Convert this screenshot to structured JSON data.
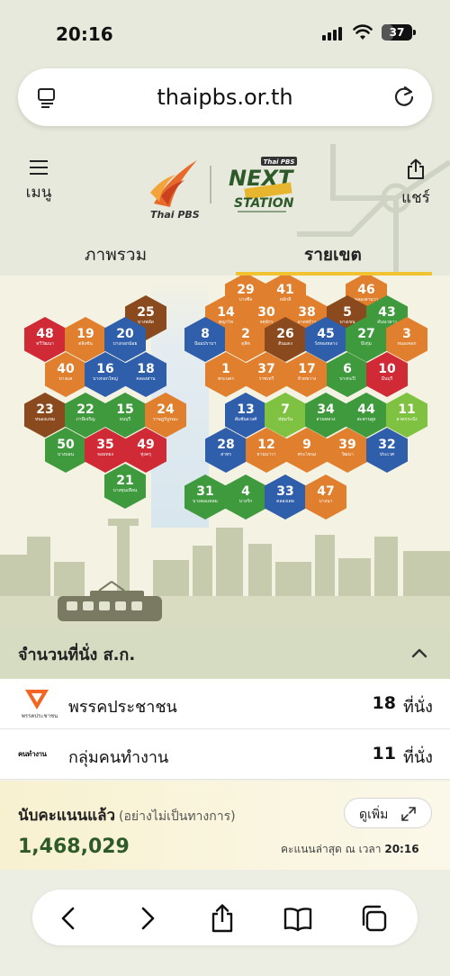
{
  "status_bar": {
    "time": "20:16",
    "battery": "37",
    "battery_level": 0.37
  },
  "browser": {
    "domain": "thaipbs.or.th"
  },
  "header": {
    "menu_label": "เมนู",
    "share_label": "แชร์",
    "logo_text": "Thai PBS",
    "event_logo_text": "Thai PBS NEXT STATION"
  },
  "tabs": [
    {
      "label": "ภาพรวม",
      "active": false
    },
    {
      "label": "รายเขต",
      "active": true
    }
  ],
  "map": {
    "colors": {
      "orange": "#e07f2e",
      "brown": "#8a4a1e",
      "blue": "#2f5fab",
      "green": "#3e9a3c",
      "lightgreen": "#7fc241",
      "red": "#cf2a36"
    },
    "districts": [
      {
        "n": "29",
        "name": "บางซื่อ",
        "c": "orange"
      },
      {
        "n": "41",
        "name": "หลักสี่",
        "c": "orange"
      },
      {
        "n": "46",
        "name": "คลองสามวา",
        "c": "orange"
      },
      {
        "n": "25",
        "name": "บางพลัด",
        "c": "brown"
      },
      {
        "n": "14",
        "name": "พญาไท",
        "c": "orange"
      },
      {
        "n": "30",
        "name": "จตุจักร",
        "c": "orange"
      },
      {
        "n": "38",
        "name": "ลาดพร้าว",
        "c": "orange"
      },
      {
        "n": "5",
        "name": "บางเขน",
        "c": "brown"
      },
      {
        "n": "43",
        "name": "คันนายาว",
        "c": "green"
      },
      {
        "n": "48",
        "name": "ทวีวัฒนา",
        "c": "red"
      },
      {
        "n": "19",
        "name": "ตลิ่งชัน",
        "c": "orange"
      },
      {
        "n": "20",
        "name": "บางกอกน้อย",
        "c": "blue"
      },
      {
        "n": "8",
        "name": "ป้อมปราบฯ",
        "c": "blue"
      },
      {
        "n": "2",
        "name": "ดุสิต",
        "c": "orange"
      },
      {
        "n": "26",
        "name": "ดินแดง",
        "c": "brown"
      },
      {
        "n": "45",
        "name": "วังทองหลาง",
        "c": "blue"
      },
      {
        "n": "27",
        "name": "บึงกุ่ม",
        "c": "green"
      },
      {
        "n": "3",
        "name": "หนองจอก",
        "c": "orange"
      },
      {
        "n": "40",
        "name": "บางแค",
        "c": "orange"
      },
      {
        "n": "16",
        "name": "บางกอกใหญ่",
        "c": "blue"
      },
      {
        "n": "18",
        "name": "คลองสาน",
        "c": "blue"
      },
      {
        "n": "1",
        "name": "พระนคร",
        "c": "orange"
      },
      {
        "n": "37",
        "name": "ราชเทวี",
        "c": "orange"
      },
      {
        "n": "17",
        "name": "ห้วยขวาง",
        "c": "orange"
      },
      {
        "n": "6",
        "name": "บางกะปิ",
        "c": "green"
      },
      {
        "n": "10",
        "name": "มีนบุรี",
        "c": "red"
      },
      {
        "n": "23",
        "name": "หนองแขม",
        "c": "brown"
      },
      {
        "n": "22",
        "name": "ภาษีเจริญ",
        "c": "green"
      },
      {
        "n": "15",
        "name": "ธนบุรี",
        "c": "green"
      },
      {
        "n": "24",
        "name": "ราษฎร์บูรณะ",
        "c": "orange"
      },
      {
        "n": "13",
        "name": "สัมพันธวงศ์",
        "c": "blue"
      },
      {
        "n": "7",
        "name": "ปทุมวัน",
        "c": "lightgreen"
      },
      {
        "n": "34",
        "name": "สวนหลวง",
        "c": "green"
      },
      {
        "n": "44",
        "name": "สะพานสูง",
        "c": "green"
      },
      {
        "n": "11",
        "name": "ลาดกระบัง",
        "c": "lightgreen"
      },
      {
        "n": "50",
        "name": "บางบอน",
        "c": "green"
      },
      {
        "n": "35",
        "name": "จอมทอง",
        "c": "red"
      },
      {
        "n": "49",
        "name": "ทุ่งครุ",
        "c": "red"
      },
      {
        "n": "28",
        "name": "สาทร",
        "c": "blue"
      },
      {
        "n": "12",
        "name": "ยานนาวา",
        "c": "orange"
      },
      {
        "n": "9",
        "name": "พระโขนง",
        "c": "orange"
      },
      {
        "n": "39",
        "name": "วัฒนา",
        "c": "orange"
      },
      {
        "n": "32",
        "name": "ประเวศ",
        "c": "blue"
      },
      {
        "n": "21",
        "name": "บางขุนเทียน",
        "c": "green"
      },
      {
        "n": "31",
        "name": "บางคอแหลม",
        "c": "green"
      },
      {
        "n": "4",
        "name": "บางรัก",
        "c": "green"
      },
      {
        "n": "33",
        "name": "คลองเตย",
        "c": "blue"
      },
      {
        "n": "47",
        "name": "บางนา",
        "c": "orange"
      }
    ]
  },
  "seats": {
    "title": "จำนวนที่นั่ง ส.ก.",
    "parties": [
      {
        "name": "พรรคประชาชน",
        "logo_caption": "พรรคประชาชน",
        "seats": "18",
        "unit": "ที่นั่ง",
        "color": "#f26522"
      },
      {
        "name": "กลุ่มคนทำงาน",
        "logo_caption": "คนทำงาน",
        "seats": "11",
        "unit": "ที่นั่ง",
        "color": "#111111"
      }
    ]
  },
  "counter": {
    "title": "นับคะแนนแล้ว",
    "subtitle": "(อย่างไม่เป็นทางการ)",
    "more_label": "ดูเพิ่ม",
    "total": "1,468,029",
    "updated_label": "คะแนนล่าสุด ณ เวลา",
    "updated_time": "20:16"
  }
}
